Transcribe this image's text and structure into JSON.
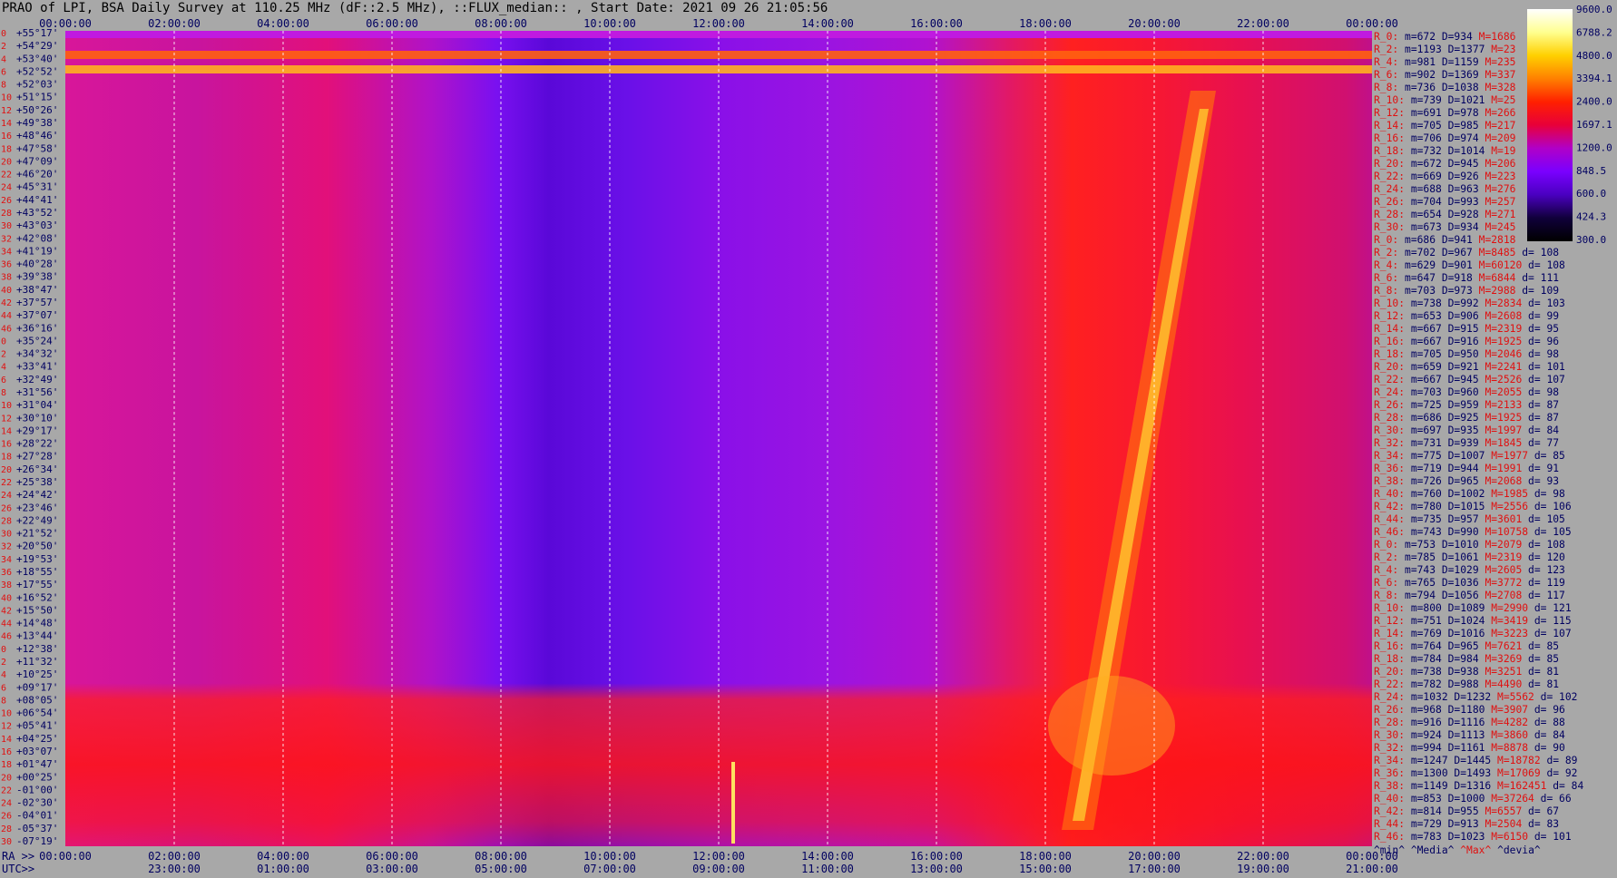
{
  "title": "PRAO of LPI, BSA Daily Survey at 110.25 MHz (dF::2.5 MHz), ::FLUX_median:: , Start Date: 2021 09 26 21:05:56",
  "colors": {
    "background": "#a8a8a8",
    "text": "#000060",
    "accent": "#e01010"
  },
  "chart_data": {
    "type": "heatmap",
    "title": "PRAO of LPI, BSA Daily Survey at 110.25 MHz (dF::2.5 MHz), ::FLUX_median:: , Start Date: 2021 09 26 21:05:56",
    "x_top_ticks": [
      "00:00:00",
      "02:00:00",
      "04:00:00",
      "06:00:00",
      "08:00:00",
      "10:00:00",
      "12:00:00",
      "14:00:00",
      "16:00:00",
      "18:00:00",
      "20:00:00",
      "22:00:00",
      "00:00:00"
    ],
    "ra_label": "RA >>",
    "ra_ticks": [
      "00:00:00",
      "02:00:00",
      "04:00:00",
      "06:00:00",
      "08:00:00",
      "10:00:00",
      "12:00:00",
      "14:00:00",
      "16:00:00",
      "18:00:00",
      "20:00:00",
      "22:00:00",
      "00:00:00"
    ],
    "utc_label": "UTC>>",
    "utc_ticks": [
      "23:00:00",
      "01:00:00",
      "03:00:00",
      "05:00:00",
      "07:00:00",
      "09:00:00",
      "11:00:00",
      "13:00:00",
      "15:00:00",
      "17:00:00",
      "19:00:00",
      "21:00:00"
    ],
    "row_index": [
      "0",
      "2",
      "4",
      "6",
      "8",
      "10",
      "12",
      "14",
      "16",
      "18",
      "20",
      "22",
      "24",
      "26",
      "28",
      "30",
      "32",
      "34",
      "36",
      "38",
      "40",
      "42",
      "44",
      "46"
    ],
    "dec_ticks": [
      "+55°17'",
      "+54°29'",
      "+53°40'",
      "+52°52'",
      "+52°03'",
      "+51°15'",
      "+50°26'",
      "+49°38'",
      "+48°46'",
      "+47°58'",
      "+47°09'",
      "+46°20'",
      "+45°31'",
      "+44°41'",
      "+43°52'",
      "+43°03'",
      "+42°08'",
      "+41°19'",
      "+40°28'",
      "+39°38'",
      "+38°47'",
      "+37°57'",
      "+37°07'",
      "+36°16'",
      "+35°24'",
      "+34°32'",
      "+33°41'",
      "+32°49'",
      "+31°56'",
      "+31°04'",
      "+30°10'",
      "+29°17'",
      "+28°22'",
      "+27°28'",
      "+26°34'",
      "+25°38'",
      "+24°42'",
      "+23°46'",
      "+22°49'",
      "+21°52'",
      "+20°50'",
      "+19°53'",
      "+18°55'",
      "+17°55'",
      "+16°52'",
      "+15°50'",
      "+14°48'",
      "+13°44'",
      "+12°38'",
      "+11°32'",
      "+10°25'",
      "+09°17'",
      "+08°05'",
      "+06°54'",
      "+05°41'",
      "+04°25'",
      "+03°07'",
      "+01°47'",
      "+00°25'",
      "-01°00'",
      "-02°30'",
      "-04°01'",
      "-05°37'",
      "-07°19'"
    ],
    "colorbar": {
      "ticks": [
        "9600.0",
        "6788.2",
        "4800.0",
        "3394.1",
        "2400.0",
        "1697.1",
        "1200.0",
        "848.5",
        "600.0",
        "424.3",
        "300.0"
      ],
      "colors": [
        "#ffffff",
        "#ffff90",
        "#ffd000",
        "#ff8000",
        "#ff2000",
        "#e8003a",
        "#b000c8",
        "#7a00ff",
        "#4a00c0",
        "#10003a",
        "#000000"
      ]
    },
    "stats": [
      {
        "label": "R_0:",
        "min": 672,
        "median": 934,
        "max": 1686,
        "devia": null
      },
      {
        "label": "R_2:",
        "min": 1193,
        "median": 1377,
        "max": 23,
        "devia": null
      },
      {
        "label": "R_4:",
        "min": 981,
        "median": 1159,
        "max": 235,
        "devia": null
      },
      {
        "label": "R_6:",
        "min": 902,
        "median": 1369,
        "max": 337,
        "devia": null
      },
      {
        "label": "R_8:",
        "min": 736,
        "median": 1038,
        "max": 328,
        "devia": null
      },
      {
        "label": "R_10:",
        "min": 739,
        "median": 1021,
        "max": 25,
        "devia": null
      },
      {
        "label": "R_12:",
        "min": 691,
        "median": 978,
        "max": 266,
        "devia": null
      },
      {
        "label": "R_14:",
        "min": 705,
        "median": 985,
        "max": 217,
        "devia": null
      },
      {
        "label": "R_16:",
        "min": 706,
        "median": 974,
        "max": 209,
        "devia": null
      },
      {
        "label": "R_18:",
        "min": 732,
        "median": 1014,
        "max": 19,
        "devia": null
      },
      {
        "label": "R_20:",
        "min": 672,
        "median": 945,
        "max": 206,
        "devia": null
      },
      {
        "label": "R_22:",
        "min": 669,
        "median": 926,
        "max": 223,
        "devia": null
      },
      {
        "label": "R_24:",
        "min": 688,
        "median": 963,
        "max": 276,
        "devia": null
      },
      {
        "label": "R_26:",
        "min": 704,
        "median": 993,
        "max": 257,
        "devia": null
      },
      {
        "label": "R_28:",
        "min": 654,
        "median": 928,
        "max": 271,
        "devia": null
      },
      {
        "label": "R_30:",
        "min": 673,
        "median": 934,
        "max": 245,
        "devia": null
      },
      {
        "label": "R_0:",
        "min": 686,
        "median": 941,
        "max": 2818,
        "devia": null
      },
      {
        "label": "R_2:",
        "min": 702,
        "median": 967,
        "max": 8485,
        "devia": 108
      },
      {
        "label": "R_4:",
        "min": 629,
        "median": 901,
        "max": 60120,
        "devia": 108
      },
      {
        "label": "R_6:",
        "min": 647,
        "median": 918,
        "max": 6844,
        "devia": 111
      },
      {
        "label": "R_8:",
        "min": 703,
        "median": 973,
        "max": 2988,
        "devia": 109
      },
      {
        "label": "R_10:",
        "min": 738,
        "median": 992,
        "max": 2834,
        "devia": 103
      },
      {
        "label": "R_12:",
        "min": 653,
        "median": 906,
        "max": 2608,
        "devia": 99
      },
      {
        "label": "R_14:",
        "min": 667,
        "median": 915,
        "max": 2319,
        "devia": 95
      },
      {
        "label": "R_16:",
        "min": 667,
        "median": 916,
        "max": 1925,
        "devia": 96
      },
      {
        "label": "R_18:",
        "min": 705,
        "median": 950,
        "max": 2046,
        "devia": 98
      },
      {
        "label": "R_20:",
        "min": 659,
        "median": 921,
        "max": 2241,
        "devia": 101
      },
      {
        "label": "R_22:",
        "min": 667,
        "median": 945,
        "max": 2526,
        "devia": 107
      },
      {
        "label": "R_24:",
        "min": 703,
        "median": 960,
        "max": 2055,
        "devia": 98
      },
      {
        "label": "R_26:",
        "min": 725,
        "median": 959,
        "max": 2133,
        "devia": 87
      },
      {
        "label": "R_28:",
        "min": 686,
        "median": 925,
        "max": 1925,
        "devia": 87
      },
      {
        "label": "R_30:",
        "min": 697,
        "median": 935,
        "max": 1997,
        "devia": 84
      },
      {
        "label": "R_32:",
        "min": 731,
        "median": 939,
        "max": 1845,
        "devia": 77
      },
      {
        "label": "R_34:",
        "min": 775,
        "median": 1007,
        "max": 1977,
        "devia": 85
      },
      {
        "label": "R_36:",
        "min": 719,
        "median": 944,
        "max": 1991,
        "devia": 91
      },
      {
        "label": "R_38:",
        "min": 726,
        "median": 965,
        "max": 2068,
        "devia": 93
      },
      {
        "label": "R_40:",
        "min": 760,
        "median": 1002,
        "max": 1985,
        "devia": 98
      },
      {
        "label": "R_42:",
        "min": 780,
        "median": 1015,
        "max": 2556,
        "devia": 106
      },
      {
        "label": "R_44:",
        "min": 735,
        "median": 957,
        "max": 3601,
        "devia": 105
      },
      {
        "label": "R_46:",
        "min": 743,
        "median": 990,
        "max": 10758,
        "devia": 105
      },
      {
        "label": "R_0:",
        "min": 753,
        "median": 1010,
        "max": 2079,
        "devia": 108
      },
      {
        "label": "R_2:",
        "min": 785,
        "median": 1061,
        "max": 2319,
        "devia": 120
      },
      {
        "label": "R_4:",
        "min": 743,
        "median": 1029,
        "max": 2605,
        "devia": 123
      },
      {
        "label": "R_6:",
        "min": 765,
        "median": 1036,
        "max": 3772,
        "devia": 119
      },
      {
        "label": "R_8:",
        "min": 794,
        "median": 1056,
        "max": 2708,
        "devia": 117
      },
      {
        "label": "R_10:",
        "min": 800,
        "median": 1089,
        "max": 2990,
        "devia": 121
      },
      {
        "label": "R_12:",
        "min": 751,
        "median": 1024,
        "max": 3419,
        "devia": 115
      },
      {
        "label": "R_14:",
        "min": 769,
        "median": 1016,
        "max": 3223,
        "devia": 107
      },
      {
        "label": "R_16:",
        "min": 764,
        "median": 965,
        "max": 7621,
        "devia": 85
      },
      {
        "label": "R_18:",
        "min": 784,
        "median": 984,
        "max": 3269,
        "devia": 85
      },
      {
        "label": "R_20:",
        "min": 738,
        "median": 938,
        "max": 3251,
        "devia": 81
      },
      {
        "label": "R_22:",
        "min": 782,
        "median": 988,
        "max": 4490,
        "devia": 81
      },
      {
        "label": "R_24:",
        "min": 1032,
        "median": 1232,
        "max": 5562,
        "devia": 102
      },
      {
        "label": "R_26:",
        "min": 968,
        "median": 1180,
        "max": 3907,
        "devia": 96
      },
      {
        "label": "R_28:",
        "min": 916,
        "median": 1116,
        "max": 4282,
        "devia": 88
      },
      {
        "label": "R_30:",
        "min": 924,
        "median": 1113,
        "max": 3860,
        "devia": 84
      },
      {
        "label": "R_32:",
        "min": 994,
        "median": 1161,
        "max": 8878,
        "devia": 90
      },
      {
        "label": "R_34:",
        "min": 1247,
        "median": 1445,
        "max": 18782,
        "devia": 89
      },
      {
        "label": "R_36:",
        "min": 1300,
        "median": 1493,
        "max": 17069,
        "devia": 92
      },
      {
        "label": "R_38:",
        "min": 1149,
        "median": 1316,
        "max": 162451,
        "devia": 84
      },
      {
        "label": "R_40:",
        "min": 853,
        "median": 1000,
        "max": 37264,
        "devia": 66
      },
      {
        "label": "R_42:",
        "min": 814,
        "median": 955,
        "max": 6557,
        "devia": 67
      },
      {
        "label": "R_44:",
        "min": 729,
        "median": 913,
        "max": 2504,
        "devia": 83
      },
      {
        "label": "R_46:",
        "min": 783,
        "median": 1023,
        "max": 6150,
        "devia": 101
      }
    ],
    "footer": {
      "min": "^min^",
      "median": "^Media^",
      "max": "^Max^",
      "devia": "^devia^"
    }
  }
}
